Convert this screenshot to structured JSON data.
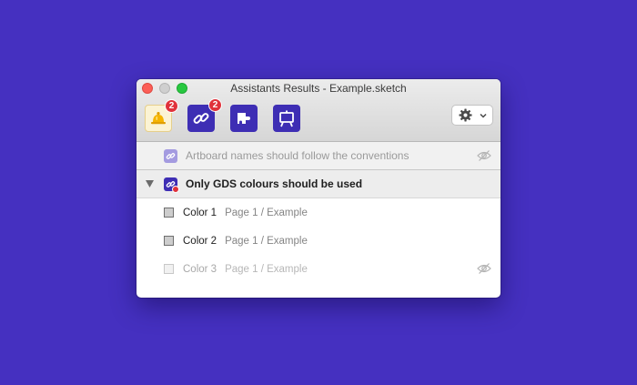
{
  "window": {
    "title": "Assistants Results - Example.sketch"
  },
  "toolbar": {
    "tools": [
      {
        "name": "bell-icon",
        "badge": "2"
      },
      {
        "name": "link-icon",
        "badge": "2"
      },
      {
        "name": "puzzle-icon",
        "badge": ""
      },
      {
        "name": "easel-icon",
        "badge": ""
      }
    ],
    "settings": {
      "icon": "gear-icon",
      "caret": "chevron-down-icon"
    }
  },
  "rules": [
    {
      "label": "Artboard names should follow the conventions",
      "state": "ignored",
      "icon": "link-icon"
    },
    {
      "label": "Only GDS colours should be used",
      "state": "expanded",
      "icon": "link-icon",
      "items": [
        {
          "name": "Color 1",
          "path": "Page 1 / Example",
          "ignored": false
        },
        {
          "name": "Color 2",
          "path": "Page 1 / Example",
          "ignored": false
        },
        {
          "name": "Color 3",
          "path": "Page 1 / Example",
          "ignored": true
        }
      ]
    }
  ],
  "colors": {
    "background": "#4530c0",
    "accent": "#3e2eb4",
    "badge": "#e0323b"
  }
}
